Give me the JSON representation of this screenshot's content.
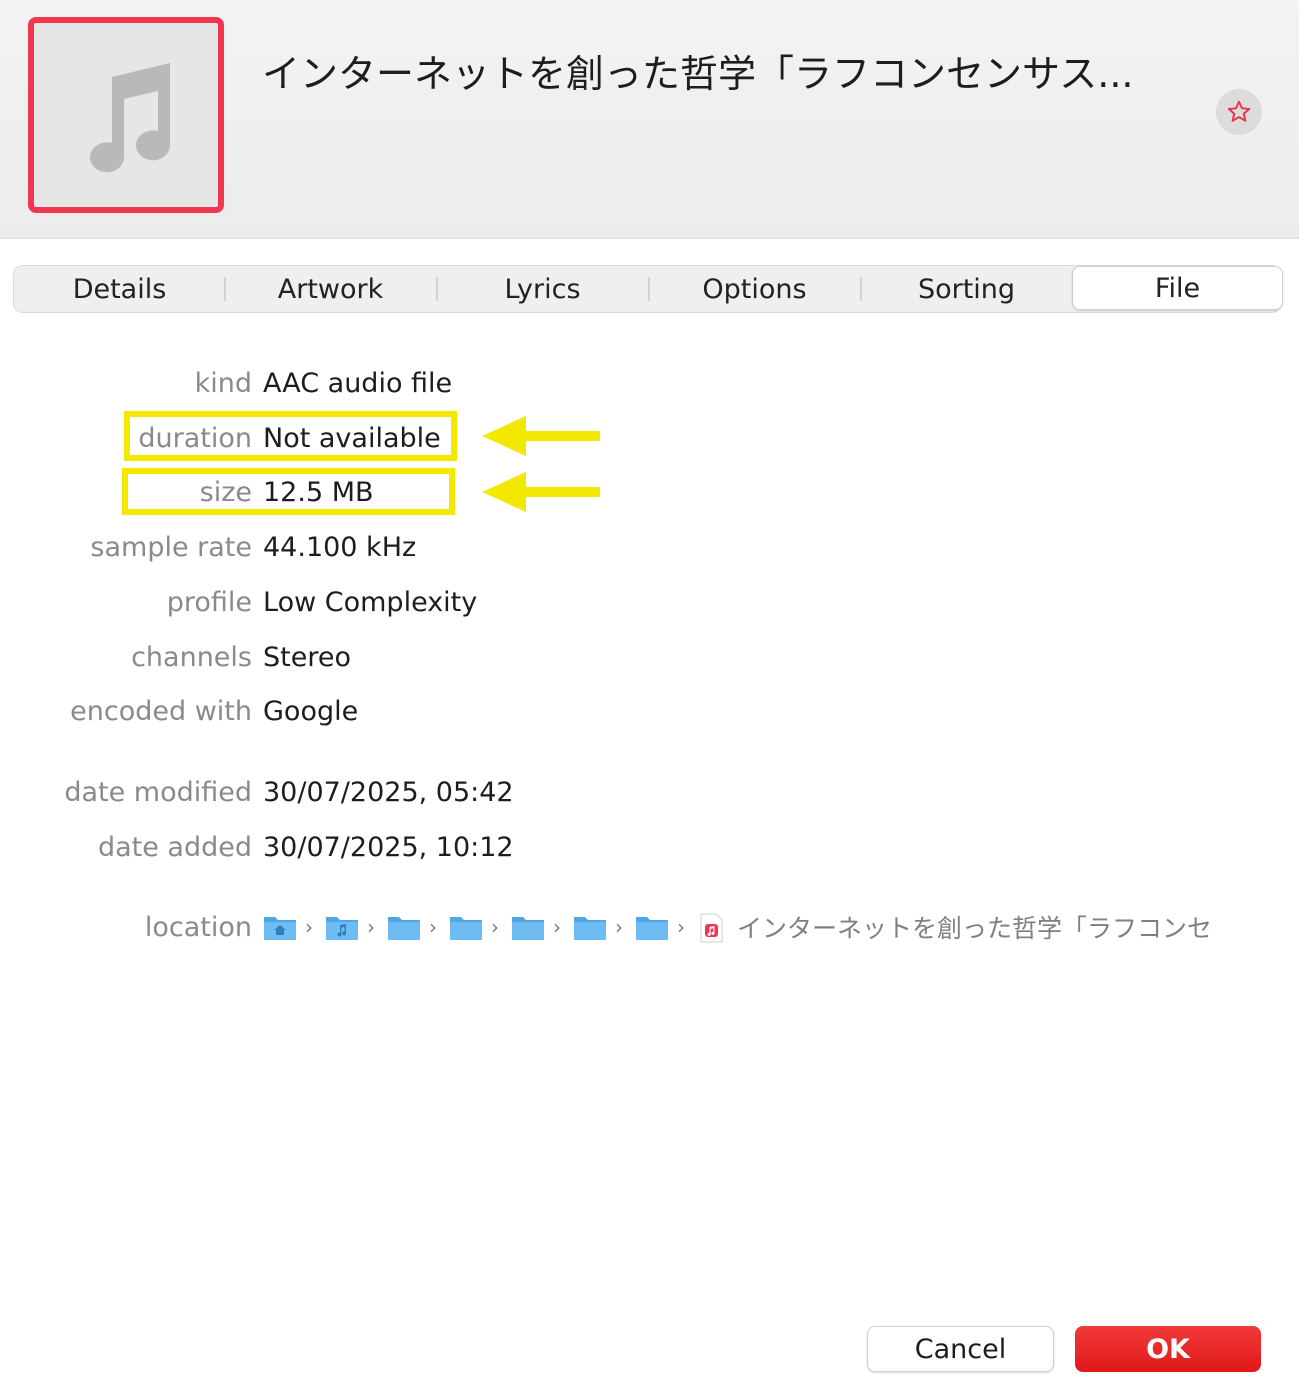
{
  "header": {
    "title": "インターネットを創った哲学「ラフコンセンサス...",
    "artwork_icon": "music-note-icon",
    "favorite_icon": "star-icon"
  },
  "tabs": [
    {
      "label": "Details"
    },
    {
      "label": "Artwork"
    },
    {
      "label": "Lyrics"
    },
    {
      "label": "Options"
    },
    {
      "label": "Sorting"
    },
    {
      "label": "File",
      "active": true
    }
  ],
  "file_info": {
    "kind": {
      "label": "kind",
      "value": "AAC audio file"
    },
    "duration": {
      "label": "duration",
      "value": "Not available"
    },
    "size": {
      "label": "size",
      "value": "12.5 MB"
    },
    "sample_rate": {
      "label": "sample rate",
      "value": "44.100 kHz"
    },
    "profile": {
      "label": "profile",
      "value": "Low Complexity"
    },
    "channels": {
      "label": "channels",
      "value": "Stereo"
    },
    "encoded_with": {
      "label": "encoded with",
      "value": "Google"
    },
    "date_modified": {
      "label": "date modified",
      "value": "30/07/2025, 05:42"
    },
    "date_added": {
      "label": "date added",
      "value": "30/07/2025, 10:12"
    }
  },
  "location": {
    "label": "location",
    "path_icons": [
      "home-folder-icon",
      "music-folder-icon",
      "folder-icon",
      "folder-icon",
      "folder-icon",
      "folder-icon",
      "folder-icon",
      "music-file-icon"
    ],
    "file_name": "インターネットを創った哲学「ラフコンセ"
  },
  "annotations": {
    "highlight_color": "#f2e800",
    "artwork_border_color": "#f0374f"
  },
  "buttons": {
    "cancel": "Cancel",
    "ok": "OK"
  }
}
